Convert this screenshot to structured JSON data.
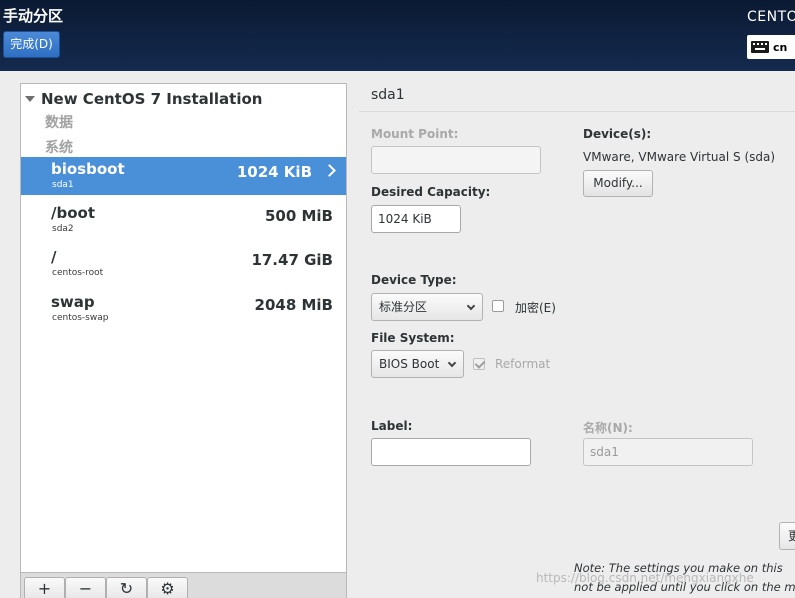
{
  "header": {
    "title": "手动分区",
    "done_label": "完成(D)",
    "os_name": "CENTO",
    "keyboard_layout": "cn"
  },
  "tree": {
    "root_label": "New CentOS 7 Installation",
    "group_data": "数据",
    "group_system": "系统",
    "partitions": [
      {
        "mount": "biosboot",
        "device": "sda1",
        "size": "1024 KiB",
        "selected": true
      },
      {
        "mount": "/boot",
        "device": "sda2",
        "size": "500 MiB",
        "selected": false
      },
      {
        "mount": "/",
        "device": "centos-root",
        "size": "17.47 GiB",
        "selected": false
      },
      {
        "mount": "swap",
        "device": "centos-swap",
        "size": "2048 MiB",
        "selected": false
      }
    ]
  },
  "toolbar": {
    "add": "+",
    "remove": "−",
    "refresh": "↻",
    "configure": "⚙"
  },
  "details": {
    "section_title": "sda1",
    "mount_point_label": "Mount Point:",
    "mount_point_value": "",
    "desired_capacity_label": "Desired Capacity:",
    "desired_capacity_value": "1024 KiB",
    "devices_label": "Device(s):",
    "devices_value": "VMware, VMware Virtual S (sda)",
    "modify_label": "Modify...",
    "device_type_label": "Device Type:",
    "device_type_value": "标准分区",
    "encrypt_label": "加密(E)",
    "encrypt_checked": false,
    "file_system_label": "File System:",
    "file_system_value": "BIOS Boot",
    "reformat_label": "Reformat",
    "reformat_checked": true,
    "label_label": "Label:",
    "label_value": "",
    "name_label": "名称(N):",
    "name_value": "sda1",
    "edge_button_label": "更",
    "note_line1": "Note:  The settings you make on this",
    "note_line2": "not be applied until you click on the m"
  },
  "watermark": "https://blog.csdn.net/mengxiangxhe"
}
